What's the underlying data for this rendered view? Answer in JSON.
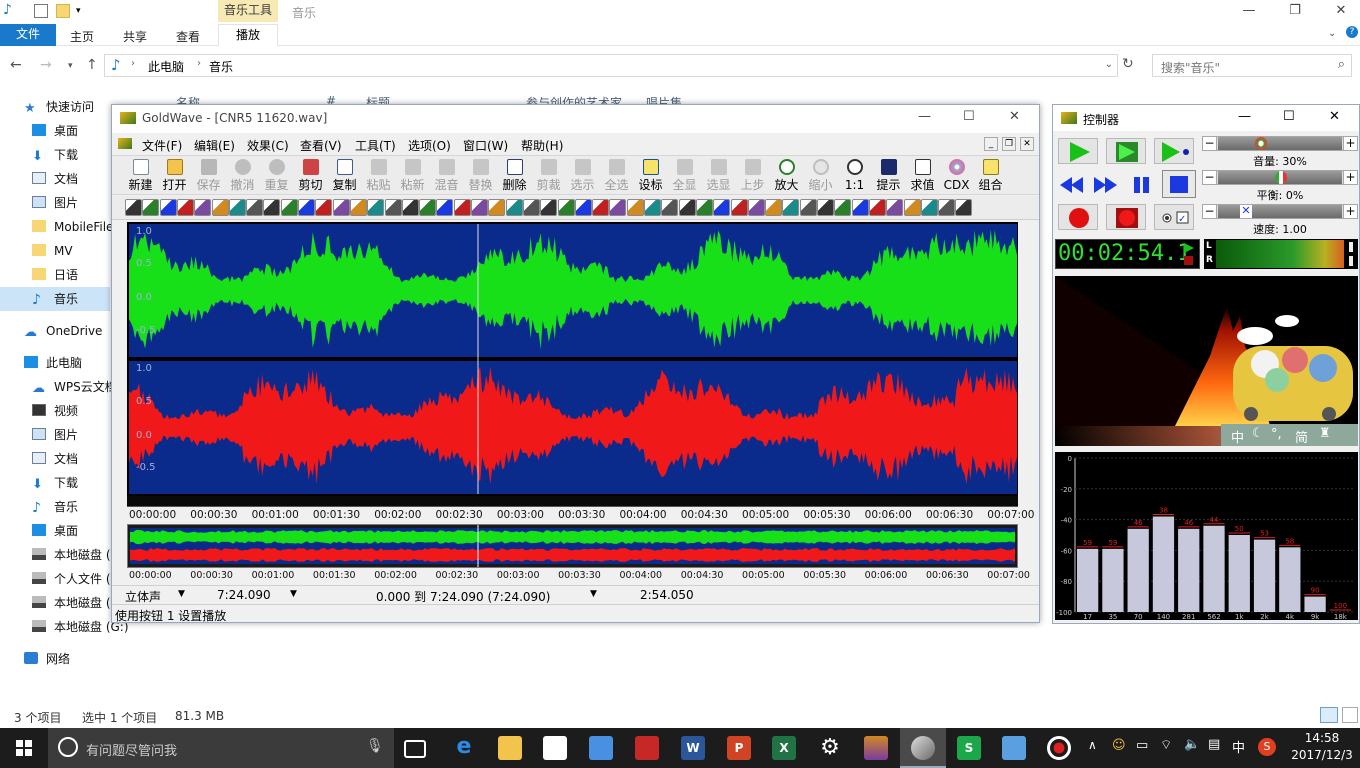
{
  "explorer": {
    "ribbon": {
      "file": "文件",
      "tabs": [
        "主页",
        "共享",
        "查看"
      ],
      "context_group": "音乐工具",
      "context_tab": "播放",
      "context_title": "音乐"
    },
    "address": {
      "path": [
        "此电脑",
        "音乐"
      ],
      "search_placeholder": "搜索\"音乐\""
    },
    "columns": [
      "名称",
      "#",
      "标题",
      "参与创作的艺术家",
      "唱片集"
    ],
    "sidebar": {
      "quick_access": "快速访问",
      "quick_items": [
        "桌面",
        "下载",
        "文档",
        "图片",
        "MobileFile",
        "MV",
        "日语",
        "音乐"
      ],
      "onedrive": "OneDrive",
      "this_pc": "此电脑",
      "pc_items": [
        "WPS云文档",
        "视频",
        "图片",
        "文档",
        "下载",
        "音乐",
        "桌面",
        "本地磁盘 (C:)",
        "个人文件 (D:)",
        "本地磁盘 (F:)",
        "本地磁盘 (G:)"
      ],
      "network": "网络"
    },
    "status": {
      "count": "3 个项目",
      "selected": "选中 1 个项目",
      "size": "81.3 MB"
    }
  },
  "goldwave": {
    "title": "GoldWave - [CNR5  11620.wav]",
    "menu": [
      "文件(F)",
      "编辑(E)",
      "效果(C)",
      "查看(V)",
      "工具(T)",
      "选项(O)",
      "窗口(W)",
      "帮助(H)"
    ],
    "toolbar": [
      "新建",
      "打开",
      "保存",
      "撤消",
      "重复",
      "剪切",
      "复制",
      "粘贴",
      "粘新",
      "混音",
      "替换",
      "删除",
      "剪裁",
      "选示",
      "全选",
      "设标",
      "全显",
      "选显",
      "上步",
      "放大",
      "缩小",
      "1:1",
      "提示",
      "求值",
      "CDX",
      "组合"
    ],
    "wave_labels": [
      "1.0",
      "0.5",
      "0.0",
      "-0.5"
    ],
    "timeline": [
      "00:00:00",
      "00:00:30",
      "00:01:00",
      "00:01:30",
      "00:02:00",
      "00:02:30",
      "00:03:00",
      "00:03:30",
      "00:04:00",
      "00:04:30",
      "00:05:00",
      "00:05:30",
      "00:06:00",
      "00:06:30",
      "00:07:00"
    ],
    "status": {
      "channel": "立体声",
      "length": "7:24.090",
      "selection": "0.000 到 7:24.090 (7:24.090)",
      "position": "2:54.050",
      "hint": "使用按钮 1 设置播放"
    }
  },
  "controller": {
    "title": "控制器",
    "volume": "音量: 30%",
    "balance": "平衡: 0%",
    "speed": "速度: 1.00",
    "time": "00:02:54.1",
    "vu": {
      "L": "L",
      "R": "R"
    },
    "eq_db": [
      "0",
      "-20",
      "-40",
      "-60",
      "-80",
      "-100"
    ],
    "eq_freqs": [
      "17",
      "35",
      "70",
      "140",
      "281",
      "562",
      "1k",
      "2k",
      "4k",
      "9k",
      "18k"
    ],
    "eq_values": [
      59,
      59,
      46,
      38,
      46,
      44,
      50,
      53,
      58,
      90,
      100
    ],
    "ime_bar": [
      "中",
      "°,",
      "简"
    ]
  },
  "taskbar": {
    "search": "有问题尽管问我",
    "time": "14:58",
    "date": "2017/12/3",
    "ime": "中"
  }
}
